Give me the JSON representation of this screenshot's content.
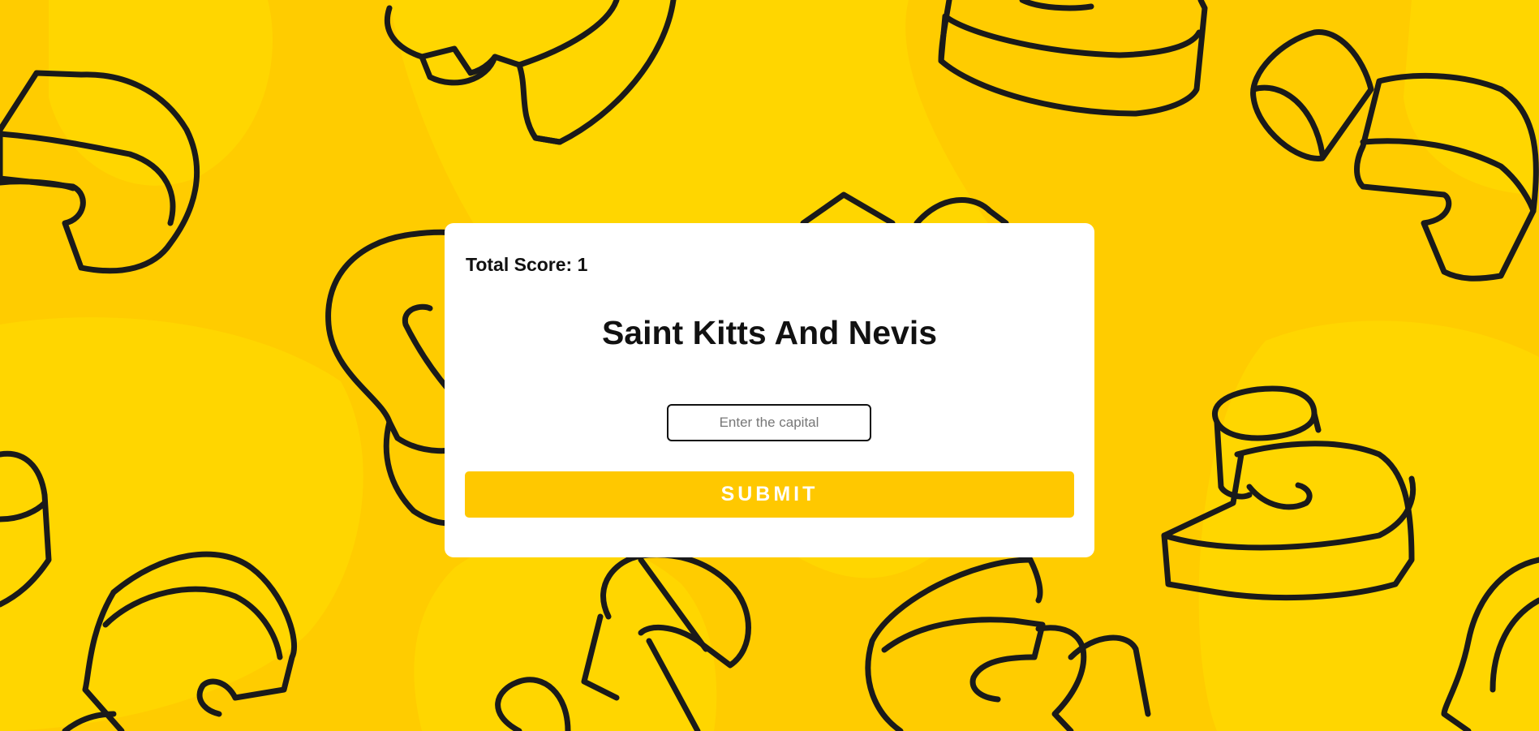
{
  "quiz": {
    "score_text": "Total Score: 1",
    "country": "Saint Kitts And Nevis",
    "input_value": "",
    "input_placeholder": "Enter the capital",
    "submit_label": "SUBMIT"
  },
  "colors": {
    "background": "#ffcc00",
    "background_blob": "#ffd600",
    "outline": "#1a1a1a",
    "card": "#ffffff",
    "button": "#ffc800",
    "button_text": "#ffffff"
  },
  "icons": {
    "background_pattern": "dollar-sign-shapes"
  }
}
